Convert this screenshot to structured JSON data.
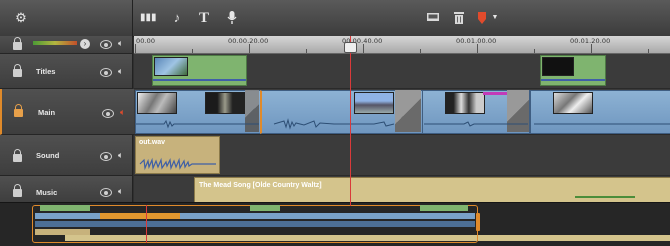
{
  "toolbar": {
    "settings_icon": "gear-icon",
    "tools": [
      "audio-levels-icon",
      "music-note-icon",
      "title-text-icon",
      "microphone-icon"
    ],
    "text_tool_glyph": "T",
    "right_tools": [
      "monitor-icon",
      "trash-icon",
      "marker-icon"
    ]
  },
  "ruler": {
    "labels": [
      "00.00",
      "00.00.20.00",
      "00.00.40.00",
      "00.01.00.00",
      "00.01.20.00"
    ]
  },
  "tracks": [
    {
      "name": "Titles"
    },
    {
      "name": "Main"
    },
    {
      "name": "Sound"
    },
    {
      "name": "Music"
    }
  ],
  "sound_clip": {
    "label": "out.wav"
  },
  "music_clip": {
    "label": "The Mead Song [Olde Country Waltz]"
  },
  "colors": {
    "playhead": "#d93a3a",
    "clip_green": "#7fb46f",
    "clip_blue": "#7aa2c9",
    "clip_tan": "#c7b27c",
    "navigator_border": "#e08a2a"
  }
}
